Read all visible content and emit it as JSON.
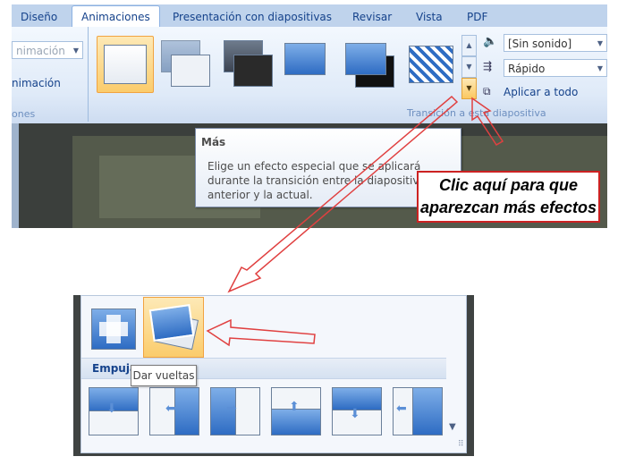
{
  "ribbon": {
    "tabs": [
      {
        "label": "Diseño"
      },
      {
        "label": "Animaciones"
      },
      {
        "label": "Presentación con diapositivas"
      },
      {
        "label": "Revisar"
      },
      {
        "label": "Vista"
      },
      {
        "label": "PDF"
      }
    ],
    "active_tab": "Animaciones",
    "left_group": {
      "dropdown_value": "nimación",
      "button_label": "nimación",
      "footer": "ones"
    },
    "transition_group": {
      "footer": "Transición a esta diapositiva",
      "sound_value": "[Sin sonido]",
      "speed_value": "Rápido",
      "apply_all_label": "Aplicar a todo"
    }
  },
  "tooltip": {
    "title": "Más",
    "lines": [
      "Elige un efecto especial que se aplicará",
      "durante la transición entre la diapositiva",
      "anterior y la actual."
    ]
  },
  "callout": {
    "line1": "Clic aquí para que",
    "line2": "aparezcan más efectos"
  },
  "gallery": {
    "section_label": "Empuja",
    "tooltip": "Dar vueltas"
  },
  "colors": {
    "annotation_red": "#cc2222",
    "selection_orange": "#f1a341",
    "ribbon_blue": "#15428b"
  }
}
